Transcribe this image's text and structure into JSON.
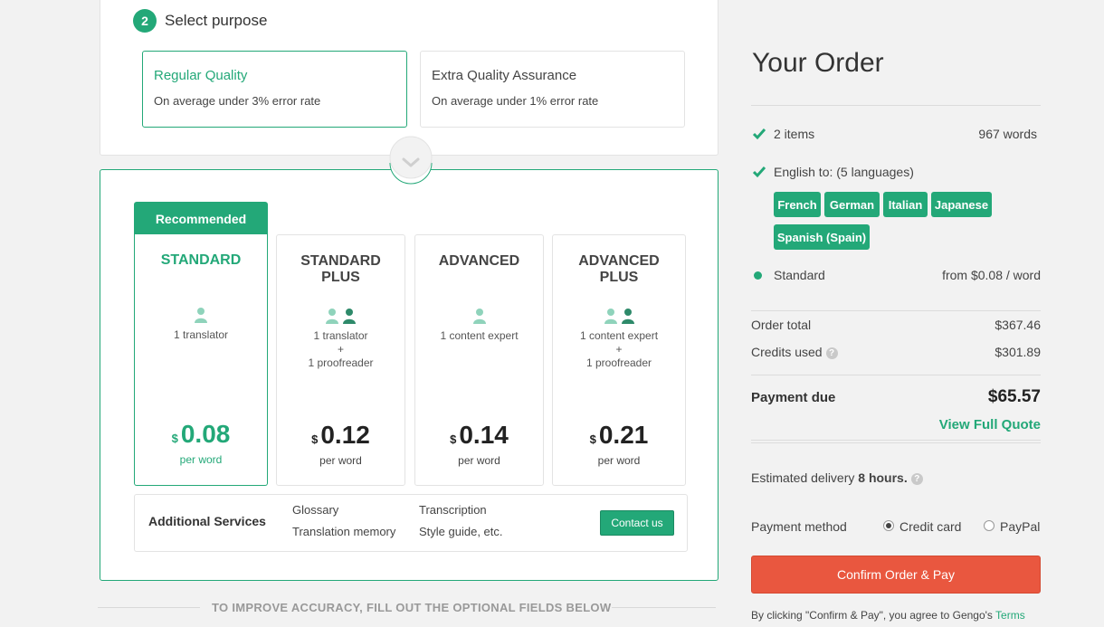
{
  "purpose": {
    "step_number": "2",
    "step_label": "Select purpose",
    "options": [
      {
        "title": "Regular Quality",
        "subtitle": "On average under 3% error rate",
        "selected": true
      },
      {
        "title": "Extra Quality Assurance",
        "subtitle": "On average under 1% error rate",
        "selected": false
      }
    ]
  },
  "pricing": {
    "recommended_label": "Recommended",
    "plans": [
      {
        "name": "STANDARD",
        "desc_lines": [
          "1 translator"
        ],
        "currency": "$",
        "price": "0.08",
        "unit": "per word",
        "icons": [
          "person-icon"
        ]
      },
      {
        "name": "STANDARD PLUS",
        "desc_lines": [
          "1 translator",
          "+",
          "1 proofreader"
        ],
        "currency": "$",
        "price": "0.12",
        "unit": "per word",
        "icons": [
          "person-icon",
          "person-dark-icon"
        ]
      },
      {
        "name": "ADVANCED",
        "desc_lines": [
          "1 content expert"
        ],
        "currency": "$",
        "price": "0.14",
        "unit": "per word",
        "icons": [
          "person-icon"
        ]
      },
      {
        "name": "ADVANCED PLUS",
        "desc_lines": [
          "1 content expert",
          "+",
          "1 proofreader"
        ],
        "currency": "$",
        "price": "0.21",
        "unit": "per word",
        "icons": [
          "person-icon",
          "person-dark-icon"
        ]
      }
    ],
    "additional": {
      "title": "Additional Services",
      "items": [
        "Glossary",
        "Translation memory",
        "Transcription",
        "Style guide, etc."
      ],
      "contact_label": "Contact us"
    },
    "fill_out_text": "TO IMPROVE ACCURACY, FILL OUT THE OPTIONAL FIELDS BELOW"
  },
  "order": {
    "title": "Your Order",
    "items_label": "2 items",
    "words_label": "967 words",
    "languages_label": "English to: (5 languages)",
    "languages": [
      "French",
      "German",
      "Italian",
      "Japanese",
      "Spanish (Spain)"
    ],
    "tier_label": "Standard",
    "tier_price": "from $0.08 / word",
    "order_total_label": "Order total",
    "order_total_value": "$367.46",
    "credits_label": "Credits used",
    "credits_value": "$301.89",
    "payment_due_label": "Payment due",
    "payment_due_value": "$65.57",
    "view_quote_label": "View Full Quote",
    "delivery_prefix": "Estimated delivery ",
    "delivery_value": "8 hours.",
    "payment_method_label": "Payment method",
    "payment_options": [
      {
        "label": "Credit card",
        "checked": true
      },
      {
        "label": "PayPal",
        "checked": false
      }
    ],
    "confirm_label": "Confirm Order & Pay",
    "terms_prefix": "By clicking \"Confirm & Pay\", you agree to Gengo's ",
    "terms_link": "Terms"
  },
  "colors": {
    "accent": "#23a878",
    "confirm": "#e9573f"
  }
}
